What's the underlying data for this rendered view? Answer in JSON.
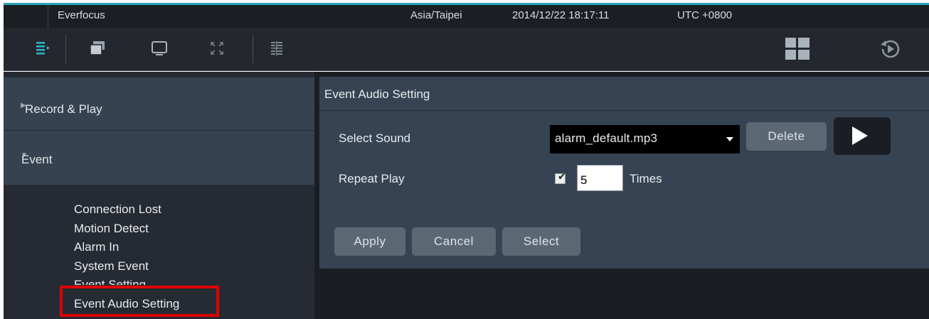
{
  "header": {
    "app_title": "Everfocus",
    "timezone": "Asia/Taipei",
    "datetime": "2014/12/22 18:17:11",
    "utc": "UTC +0800"
  },
  "toolbar": {
    "icons": [
      "menu-list-icon",
      "windows-icon",
      "monitor-icon",
      "fullscreen-icon",
      "grid-layout-icon",
      "layout-icon",
      "playback-icon"
    ]
  },
  "sidebar": {
    "categories": [
      {
        "label": "Record & Play",
        "expanded": false
      },
      {
        "label": "Event",
        "expanded": true
      }
    ],
    "event_items": [
      "Connection Lost",
      "Motion Detect",
      "Alarm In",
      "System Event",
      "Event Setting",
      "Event Audio Setting"
    ],
    "selected": "Event Audio Setting"
  },
  "panel": {
    "title": "Event Audio Setting",
    "select_sound_label": "Select Sound",
    "select_sound_value": "alarm_default.mp3",
    "delete_label": "Delete",
    "repeat_play_label": "Repeat Play",
    "repeat_checked": true,
    "repeat_times": "5",
    "times_label": "Times",
    "apply_label": "Apply",
    "cancel_label": "Cancel",
    "select_label": "Select"
  },
  "colors": {
    "accent": "#2aa7b8",
    "highlight": "#e00000",
    "panel": "#364352"
  }
}
